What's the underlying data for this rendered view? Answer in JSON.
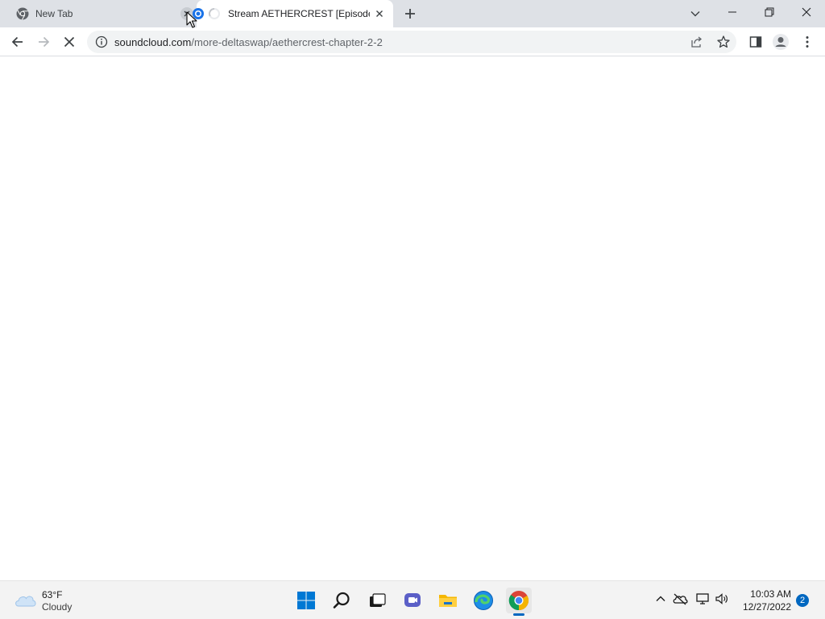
{
  "browser": {
    "tabs": [
      {
        "title": "New Tab",
        "favicon": "chrome-icon",
        "active": false
      },
      {
        "title": "Stream AETHERCREST [Episode II",
        "favicon": "loading-spinner-icon",
        "active": true
      }
    ],
    "address_bar": {
      "domain": "soundcloud.com",
      "path": "/more-deltaswap/aethercrest-chapter-2-2"
    },
    "toolbar_icons": [
      "back-icon",
      "forward-icon",
      "stop-loading-icon",
      "info-icon",
      "share-icon",
      "star-icon",
      "side-panel-icon",
      "profile-icon",
      "menu-icon"
    ],
    "window_controls": [
      "chevron-down-icon",
      "minimize-icon",
      "restore-icon",
      "close-icon"
    ]
  },
  "taskbar": {
    "weather": {
      "temp": "63°F",
      "condition": "Cloudy"
    },
    "apps": [
      "windows-start-icon",
      "search-icon",
      "task-view-icon",
      "chat-icon",
      "file-explorer-icon",
      "edge-icon",
      "chrome-icon"
    ],
    "tray_icons": [
      "chevron-up-icon",
      "onedrive-icon",
      "network-icon",
      "volume-icon"
    ],
    "clock": {
      "time": "10:03 AM",
      "date": "12/27/2022"
    },
    "notification_count": "2"
  },
  "colors": {
    "tabstrip": "#dee1e6",
    "accent": "#0067c0",
    "taskbar": "#f3f3f3"
  }
}
